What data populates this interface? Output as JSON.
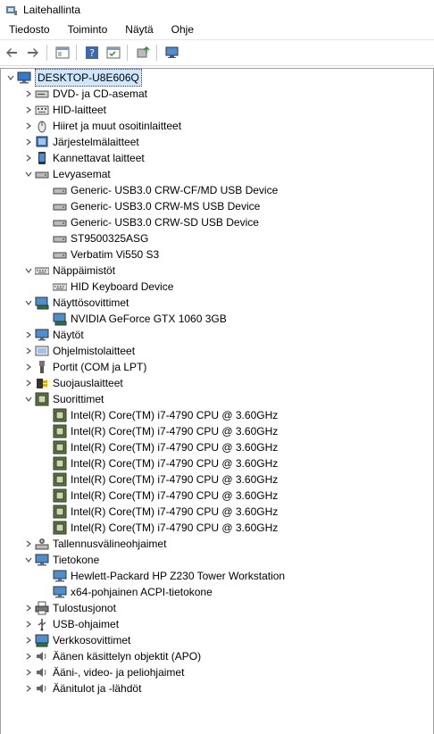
{
  "window": {
    "title": "Laitehallinta"
  },
  "menu": [
    "Tiedosto",
    "Toiminto",
    "Näytä",
    "Ohje"
  ],
  "tree": {
    "root": "DESKTOP-U8E606Q",
    "categories": [
      {
        "label": "DVD- ja CD-asemat",
        "icon": "dvd-drive-icon",
        "expanded": false
      },
      {
        "label": "HID-laitteet",
        "icon": "hid-icon",
        "expanded": false
      },
      {
        "label": "Hiiret ja muut osoitinlaitteet",
        "icon": "mouse-icon",
        "expanded": false
      },
      {
        "label": "Järjestelmälaitteet",
        "icon": "system-devices-icon",
        "expanded": false
      },
      {
        "label": "Kannettavat laitteet",
        "icon": "portable-device-icon",
        "expanded": false
      },
      {
        "label": "Levyasemat",
        "icon": "disk-drive-icon",
        "expanded": true,
        "children": [
          "Generic- USB3.0 CRW-CF/MD USB Device",
          "Generic- USB3.0 CRW-MS USB Device",
          "Generic- USB3.0 CRW-SD USB Device",
          "ST9500325ASG",
          "Verbatim Vi550 S3"
        ]
      },
      {
        "label": "Näppäimistöt",
        "icon": "keyboard-icon",
        "expanded": true,
        "children": [
          "HID Keyboard Device"
        ]
      },
      {
        "label": "Näyttösovittimet",
        "icon": "display-adapter-icon",
        "expanded": true,
        "children": [
          "NVIDIA GeForce GTX 1060 3GB"
        ]
      },
      {
        "label": "Näytöt",
        "icon": "monitor-icon",
        "expanded": false
      },
      {
        "label": "Ohjelmistolaitteet",
        "icon": "software-device-icon",
        "expanded": false
      },
      {
        "label": "Portit (COM ja LPT)",
        "icon": "port-icon",
        "expanded": false
      },
      {
        "label": "Suojauslaitteet",
        "icon": "security-device-icon",
        "expanded": false
      },
      {
        "label": "Suorittimet",
        "icon": "processor-icon",
        "expanded": true,
        "children": [
          "Intel(R) Core(TM) i7-4790 CPU @ 3.60GHz",
          "Intel(R) Core(TM) i7-4790 CPU @ 3.60GHz",
          "Intel(R) Core(TM) i7-4790 CPU @ 3.60GHz",
          "Intel(R) Core(TM) i7-4790 CPU @ 3.60GHz",
          "Intel(R) Core(TM) i7-4790 CPU @ 3.60GHz",
          "Intel(R) Core(TM) i7-4790 CPU @ 3.60GHz",
          "Intel(R) Core(TM) i7-4790 CPU @ 3.60GHz",
          "Intel(R) Core(TM) i7-4790 CPU @ 3.60GHz"
        ]
      },
      {
        "label": "Tallennusvälineohjaimet",
        "icon": "storage-controller-icon",
        "expanded": false
      },
      {
        "label": "Tietokone",
        "icon": "computer-icon",
        "expanded": true,
        "children": [
          "Hewlett-Packard HP Z230 Tower Workstation",
          "x64-pohjainen ACPI-tietokone"
        ]
      },
      {
        "label": "Tulostusjonot",
        "icon": "print-queue-icon",
        "expanded": false
      },
      {
        "label": "USB-ohjaimet",
        "icon": "usb-controller-icon",
        "expanded": false
      },
      {
        "label": "Verkkosovittimet",
        "icon": "network-adapter-icon",
        "expanded": false
      },
      {
        "label": "Äänen käsittelyn objektit (APO)",
        "icon": "audio-processing-icon",
        "expanded": false
      },
      {
        "label": "Ääni-, video- ja peliohjaimet",
        "icon": "sound-video-icon",
        "expanded": false
      },
      {
        "label": "Äänitulot ja -lähdöt",
        "icon": "audio-io-icon",
        "expanded": false
      }
    ]
  }
}
